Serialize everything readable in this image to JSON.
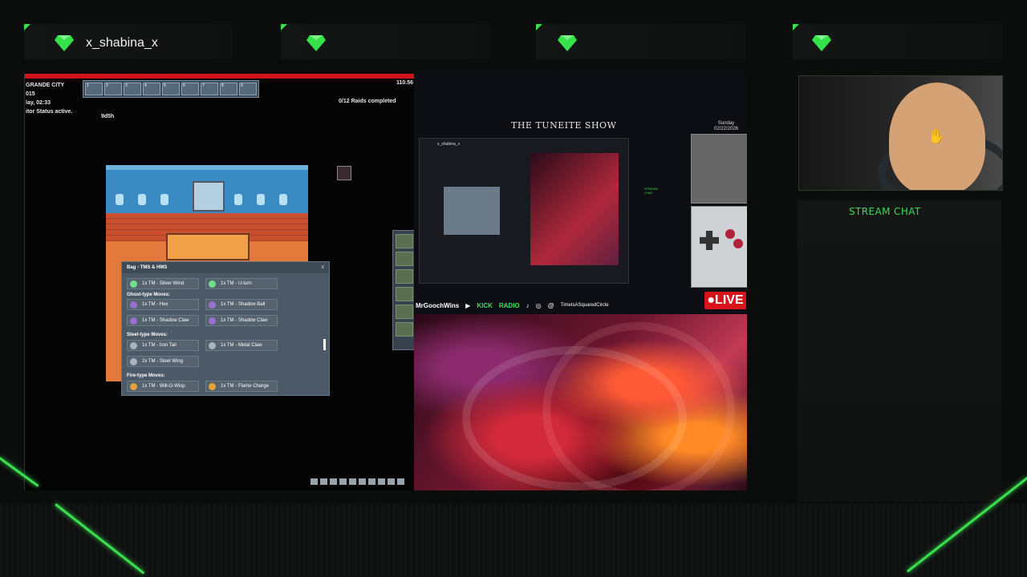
{
  "overlay": {
    "username": "x_shabina_x",
    "accent_color": "#35e24a",
    "gem_icons": [
      "gem-icon",
      "gem-icon",
      "gem-icon",
      "gem-icon"
    ],
    "stream_chat_label": "STREAM CHAT"
  },
  "game": {
    "location": "GRANDE CITY",
    "line2": "015",
    "time": "lay, 02:33",
    "status": "itor Status active.",
    "timer": "9d5h",
    "fps_readout": "110.56",
    "raids": "0/12 Raids completed",
    "hotbar_numbers": [
      "1",
      "2",
      "3",
      "4",
      "5",
      "6",
      "7",
      "8",
      "9"
    ],
    "bag": {
      "title": "Bag - TMS & HMS",
      "close_label": "x",
      "categories": [
        "Ghost-type Moves:",
        "Steel-type Moves:",
        "Fire-type Moves:"
      ],
      "items_top": [
        "1x TM - Silver Wind",
        "1x TM - U-turn"
      ],
      "ghost": [
        "1x TM - Hex",
        "1x TM - Shadow Ball",
        "1x TM - Shadow Claw",
        "1x TM - Shadow Claw"
      ],
      "steel": [
        "1x TM - Iron Tail",
        "1x TM - Metal Claw",
        "2x TM - Steel Wing"
      ],
      "fire": [
        "1x TM - Will-O-Wisp",
        "1x TM - Flame Charge"
      ]
    }
  },
  "stream": {
    "show_title": "THE TUNEITE SHOW",
    "date_day": "Sunday",
    "date": "02/22/2026",
    "twitch_handle": "MrGoochWins",
    "kick_label": "KICK",
    "radio_label": "RADIO",
    "tiktok_label": "TikTok",
    "circle_handle": "TimeIsASquaredCircle",
    "live_label": "LIVE",
    "mini_username": "x_shabina_x",
    "mini_chat": "STREAM CHAT"
  }
}
